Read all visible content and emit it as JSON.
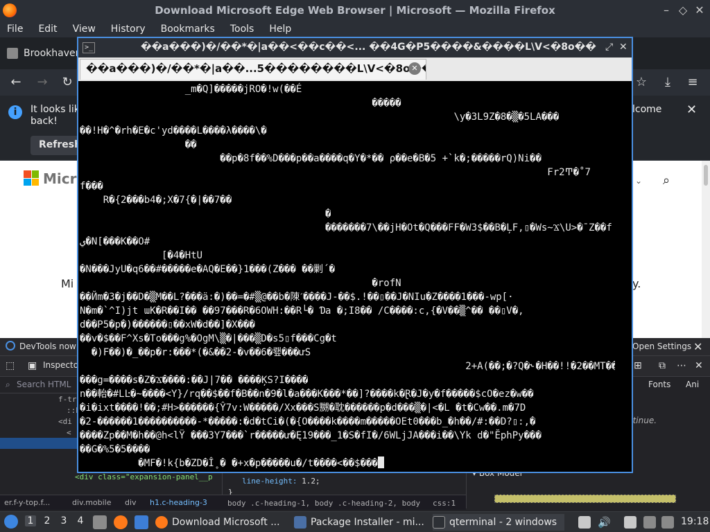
{
  "firefox": {
    "window_title": "Download Microsoft Edge Web Browser | Microsoft — Mozilla Firefox",
    "menu": [
      "File",
      "Edit",
      "View",
      "History",
      "Bookmarks",
      "Tools",
      "Help"
    ],
    "tab_label": "Brookhaven",
    "infobar": {
      "text_line1": "It looks lik",
      "text_line2": "back!",
      "refresh_label": "Refresh",
      "welcome_text": "lcome"
    },
    "page": {
      "brand_text": "Microsoft",
      "partial_left": "Mi",
      "partial_right": "y."
    }
  },
  "devtools": {
    "notice_text": "DevTools now f",
    "open_settings_label": "Open Settings",
    "inspector_tab": "Inspecto",
    "search_placeholder": "Search HTML",
    "tree_rows": [
      {
        "text": "f-tr"
      },
      {
        "text": "::b"
      },
      {
        "text": "<di"
      },
      {
        "text": "<"
      },
      {
        "text": "<div class=\"expansion-panel__p"
      }
    ],
    "rule_property": "line-height:",
    "rule_value": " 1.2;",
    "rule_brace": "}",
    "rules_footer": "body .c-heading-1, body .c-heading-2, body",
    "rules_footer_src": "css:1",
    "fonts_tab": "Fonts",
    "animations_tab": "Ani",
    "continue_text": "ntinue.",
    "box_model_label": "Box Model",
    "breadcrumbs": [
      "er.f-y-top.f...",
      "div.mobile",
      "div",
      "h1.c-heading-3"
    ]
  },
  "terminal": {
    "window_title": "��a���)�/��*�|a��<��c��<... ��4G�P5����&����L\\V<�8o��",
    "tab_label": "��a���)�/��*�|a��...5��������L\\V<�8o��",
    "lines": [
      "                  _m�Q]�����jRO�!w(��É",
      "                                                  �����",
      "                                                                \\y�3L9Z�8�▒�5LA���",
      "��!H�^�rh�E�c'yd����L����λ����\\�",
      "                  ��",
      "                        ��p�8f��%D���p��a����q�Y�*�� ρ��e�B�5 +`k�;�����rQ)Ni��",
      "                                                                                Fr2Ͳ�˚7",
      "f���",
      "    R�{2���b4�;X�7{�|��7��",
      "                                          �",
      "                                          �������7\\��jH�Ot�Q���FF�W3$��B�ĻF,▯�Ws~Ϫ\\U>�¯Z��f",
      "ي�N[���K��O#",
      "              [�4�HtU",
      "�N���JyU�q6��#�����e�AQ�E��}1���(Z��� ��剿´�",
      "                                                  �rofN",
      "��Йm�3�j��D�▒M��L?���ä:�)��=�#▒@��b�陳ˊ����J-��$.!��▯��J�NIu�Z����1���-wp[·",
      "N�m�`^I)jt ɯK�R��I�� ��97���R�6OWH:��R└� Ɗa �;I8�� /C����:c,{�V��▒^�� ��▯V�,",
      "d��P5�p�)������▯��xW�d��]�X���",
      "��v�$��F^Xs�To���g%�OgM\\▒�|���▒D�s5▯f���Cg�t",
      "  �)F��)�_��p�r:���*(�&��2-�v��6�뢮���ưS",
      "                                                                  2+A(��;�?Q�˞�H��!!�2��MT��z������W·",
      "���g=����s�Z�Ϫ����:��J|7�� ����ĶS?I����",
      "n��軩�#LĿ�~����<Y}/rq��$��f�B��n�9�l�a���K���*��]?����k�Ɽ�J�y�f�����$cO�ez�w��",
      "�i�ixt����!��;#H>������{Ŷ7v:W�����/Xx���S嬲�耽������p�d���▒�|<�L �t�Cw��.m�7D",
      "�2-������1����������-*�����:�d�tCi�(�{O����k����m�����OEt0���b_�h��/#:��D?▯:,�",
      "����Zp��M�h��@h<lŸ ���3Y7���`r�����ư�Ę19���_1�S�fI�/6WLjJA���i��\\Yk d�\"ĔphPy���",
      "��G�%5�5����",
      "          �MF�!k{b�ZD�Î˳� �+x�p�����u�/t����<��$���"
    ]
  },
  "taskbar": {
    "workspaces": [
      "1",
      "2",
      "3",
      "4"
    ],
    "tasks": [
      "Download Microsoft ...",
      "Package Installer - mi...",
      "qterminal - 2 windows"
    ],
    "clock": "19:18"
  },
  "colors": {
    "accent": "#4a90e2",
    "terminal_bg": "#000000",
    "terminal_fg": "#e8e8e8"
  }
}
